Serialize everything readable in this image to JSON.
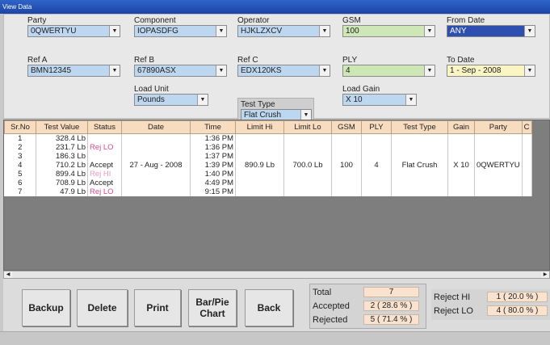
{
  "window": {
    "title": "View Data"
  },
  "filters": {
    "party": {
      "label": "Party",
      "value": "0QWERTYU"
    },
    "component": {
      "label": "Component",
      "value": "IOPASDFG"
    },
    "operator": {
      "label": "Operator",
      "value": "HJKLZXCV"
    },
    "gsm": {
      "label": "GSM",
      "value": "100"
    },
    "from_date": {
      "label": "From Date",
      "value": "ANY"
    },
    "ref_a": {
      "label": "Ref A",
      "value": "BMN12345"
    },
    "ref_b": {
      "label": "Ref B",
      "value": "67890ASX"
    },
    "ref_c": {
      "label": "Ref C",
      "value": "EDX120KS"
    },
    "ply": {
      "label": "PLY",
      "value": "4"
    },
    "to_date": {
      "label": "To Date",
      "value": "1 - Sep - 2008"
    },
    "load_unit": {
      "label": "Load Unit",
      "value": "Pounds"
    },
    "test_type": {
      "label": "Test Type",
      "value": "Flat Crush"
    },
    "load_gain": {
      "label": "Load Gain",
      "value": "X 10"
    }
  },
  "table": {
    "columns": [
      "Sr.No",
      "Test Value",
      "Status",
      "Date",
      "Time",
      "Limit Hi",
      "Limit Lo",
      "GSM",
      "PLY",
      "Test Type",
      "Gain",
      "Party",
      "C"
    ],
    "rows": [
      {
        "sr": "1",
        "value": "328.4  Lb",
        "status": "",
        "date": "",
        "time": "1:36 PM",
        "limit_hi": "",
        "limit_lo": "",
        "gsm": "",
        "ply": "",
        "test_type": "",
        "gain": "",
        "party": ""
      },
      {
        "sr": "2",
        "value": "231.7  Lb",
        "status": "Rej LO",
        "date": "",
        "time": "1:36 PM",
        "limit_hi": "",
        "limit_lo": "",
        "gsm": "",
        "ply": "",
        "test_type": "",
        "gain": "",
        "party": ""
      },
      {
        "sr": "3",
        "value": "186.3  Lb",
        "status": "",
        "date": "",
        "time": "1:37 PM",
        "limit_hi": "",
        "limit_lo": "",
        "gsm": "",
        "ply": "",
        "test_type": "",
        "gain": "",
        "party": ""
      },
      {
        "sr": "4",
        "value": "710.2  Lb",
        "status": "Accept",
        "date": "27 - Aug - 2008",
        "time": "1:39 PM",
        "limit_hi": "890.9  Lb",
        "limit_lo": "700.0  Lb",
        "gsm": "100",
        "ply": "4",
        "test_type": "Flat Crush",
        "gain": "X 10",
        "party": "0QWERTYU"
      },
      {
        "sr": "5",
        "value": "899.4  Lb",
        "status": "Rej HI",
        "date": "",
        "time": "1:40 PM",
        "limit_hi": "",
        "limit_lo": "",
        "gsm": "",
        "ply": "",
        "test_type": "",
        "gain": "",
        "party": ""
      },
      {
        "sr": "6",
        "value": "708.9  Lb",
        "status": "Accept",
        "date": "",
        "time": "4:49 PM",
        "limit_hi": "",
        "limit_lo": "",
        "gsm": "",
        "ply": "",
        "test_type": "",
        "gain": "",
        "party": ""
      },
      {
        "sr": "7",
        "value": "47.9  Lb",
        "status": "Rej LO",
        "date": "",
        "time": "9:15 PM",
        "limit_hi": "",
        "limit_lo": "",
        "gsm": "",
        "ply": "",
        "test_type": "",
        "gain": "",
        "party": ""
      }
    ]
  },
  "buttons": {
    "backup": "Backup",
    "delete": "Delete",
    "print": "Print",
    "chart": "Bar/Pie\nChart",
    "back": "Back"
  },
  "summary": {
    "total_label": "Total",
    "total_value": "7",
    "accepted_label": "Accepted",
    "accepted_value": "2 ( 28.6 % )",
    "rejected_label": "Rejected",
    "rejected_value": "5 ( 71.4 % )",
    "reject_hi_label": "Reject HI",
    "reject_hi_value": "1 ( 20.0 % )",
    "reject_lo_label": "Reject LO",
    "reject_lo_value": "4 ( 80.0 % )"
  }
}
